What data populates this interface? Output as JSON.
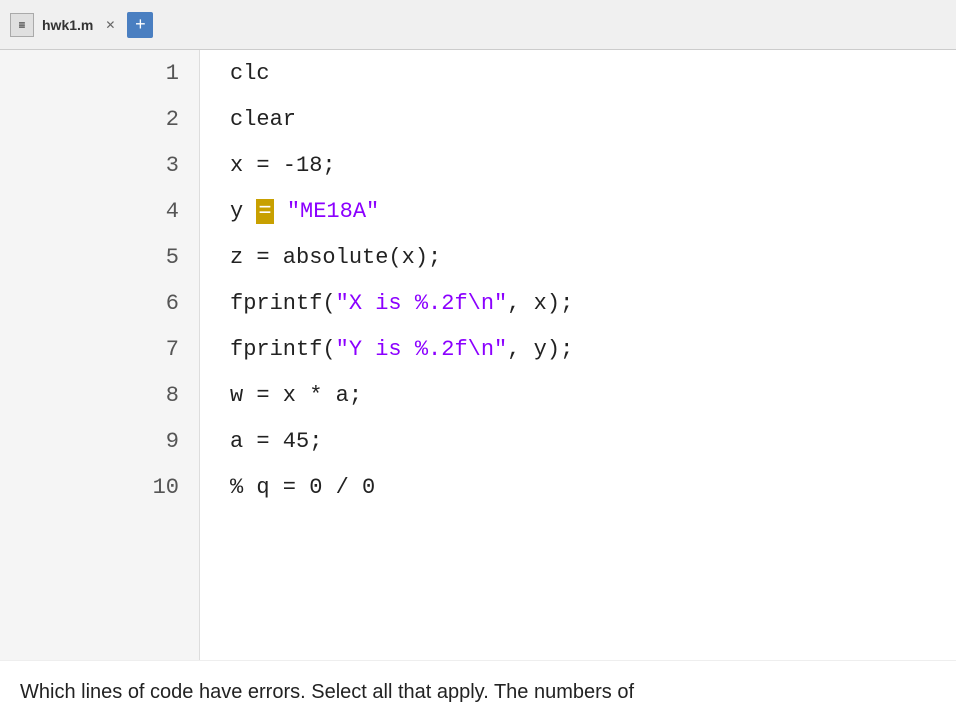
{
  "top_bar": {
    "filename": "hwk1.m",
    "close_icon": "✕",
    "plus_label": "+"
  },
  "lines": [
    {
      "number": "1",
      "code": [
        {
          "text": "clc",
          "style": "plain"
        }
      ]
    },
    {
      "number": "2",
      "code": [
        {
          "text": "clear",
          "style": "plain"
        }
      ]
    },
    {
      "number": "3",
      "code": [
        {
          "text": "x = -18;",
          "style": "plain"
        }
      ]
    },
    {
      "number": "4",
      "code": [
        {
          "text": "y ",
          "style": "plain"
        },
        {
          "text": "=",
          "style": "highlight-eq"
        },
        {
          "text": " ",
          "style": "plain"
        },
        {
          "text": "\"ME18A\"",
          "style": "kw-purple"
        }
      ]
    },
    {
      "number": "5",
      "code": [
        {
          "text": "z = absolute(x);",
          "style": "plain"
        }
      ]
    },
    {
      "number": "6",
      "code": [
        {
          "text": "fprintf(",
          "style": "plain"
        },
        {
          "text": "\"X is %.2f\\n\"",
          "style": "kw-purple"
        },
        {
          "text": ", x);",
          "style": "plain"
        }
      ]
    },
    {
      "number": "7",
      "code": [
        {
          "text": "fprintf(",
          "style": "plain"
        },
        {
          "text": "\"Y is %.2f\\n\"",
          "style": "kw-purple"
        },
        {
          "text": ", y);",
          "style": "plain"
        }
      ]
    },
    {
      "number": "8",
      "code": [
        {
          "text": "w = x * a;",
          "style": "plain"
        }
      ]
    },
    {
      "number": "9",
      "code": [
        {
          "text": "a = 45;",
          "style": "plain"
        }
      ]
    },
    {
      "number": "10",
      "code": [
        {
          "text": "% q = 0 / 0",
          "style": "plain"
        }
      ]
    }
  ],
  "bottom_text": "Which lines of code have errors. Select all that apply. The numbers of"
}
